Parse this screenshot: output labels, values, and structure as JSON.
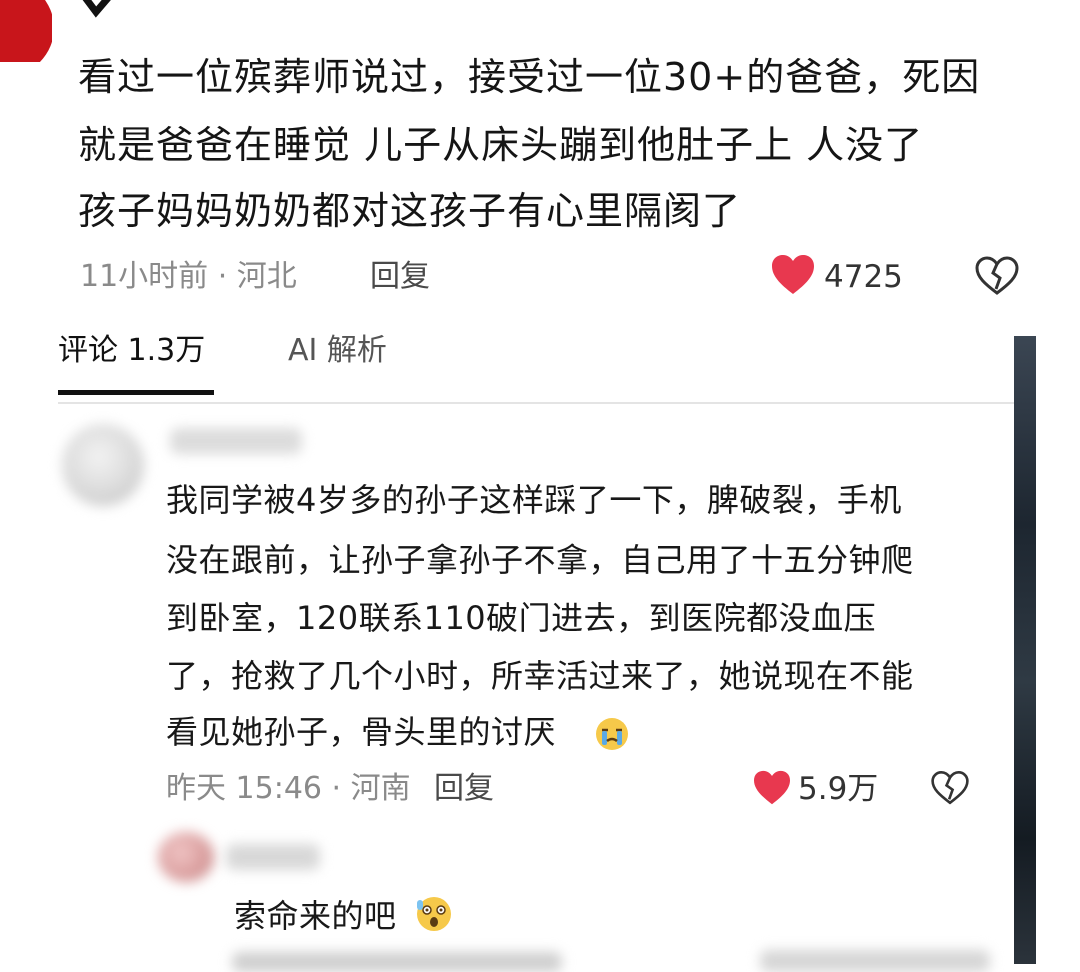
{
  "post": {
    "lines": [
      "看过一位殡葬师说过，接受过一位30+的爸爸，死因",
      "就是爸爸在睡觉  儿子从床头蹦到他肚子上  人没了",
      "孩子妈妈奶奶都对这孩子有心里隔阂了"
    ],
    "meta": "11小时前 · 河北",
    "reply_label": "回复",
    "likes": "4725"
  },
  "tabs": {
    "comments": "评论 1.3万",
    "ai": "AI 解析"
  },
  "comment1": {
    "lines": [
      "我同学被4岁多的孙子这样踩了一下，脾破裂，手机",
      "没在跟前，让孙子拿孙子不拿，自己用了十五分钟爬",
      "到卧室，120联系110破门进去，到医院都没血压",
      "了，抢救了几个小时，所幸活过来了，她说现在不能",
      "看见她孙子，骨头里的讨厌"
    ],
    "meta": "昨天 15:46 · 河南",
    "reply_label": "回复",
    "likes": "5.9万"
  },
  "reply1": {
    "text": "索命来的吧"
  },
  "colors": {
    "heart": "#e8384f",
    "tab_underline": "#111111",
    "meta": "#8a8a8a"
  },
  "icons": [
    "checkmark-icon",
    "heart-icon",
    "dislike-heart-icon",
    "crying-emoji-icon",
    "shocked-emoji-icon"
  ]
}
